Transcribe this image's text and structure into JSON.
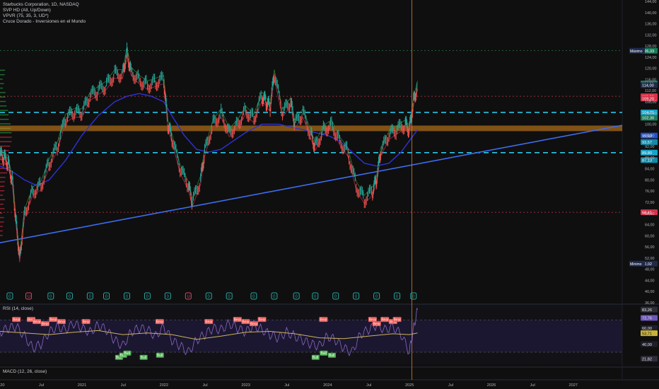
{
  "legend": {
    "symbol": "Starbucks Corporation, 1D, NASDAQ",
    "indicators": [
      "SVP HD (All, Up/Down)",
      "VPVR (75, 35, 3, UD*)",
      "Cruce Dorado - Inversiones en el Mundo"
    ]
  },
  "rsi_legend": "RSI (14, close)",
  "macd_legend": "MACD (12, 26, close)",
  "colors": {
    "background": "#0f0f0f",
    "trendline": "#3d6cf0",
    "cyan_dashed": "#27c6e6",
    "orange_zone": "#e08a1c",
    "ma_blue": "#2f32d8",
    "ma_green": "#2e8b3a",
    "ma_red": "#c8284a",
    "rsi_line": "#8768c6",
    "rsi_ma": "#c9b45a",
    "bear": "#ef5350",
    "bull": "#4caf50"
  },
  "chart_data": [
    {
      "type": "line",
      "pane": "price",
      "ylim": [
        36,
        144
      ],
      "y_ticks": [
        144,
        140,
        136,
        132,
        128,
        124,
        120,
        116,
        112,
        108,
        104,
        100,
        96,
        92,
        88,
        84,
        80,
        76,
        72,
        68,
        64,
        60,
        56,
        52,
        48,
        44,
        40,
        36
      ],
      "y_tick_labels": [
        "144,00",
        "140,00",
        "136,00",
        "132,00",
        "128,00",
        "124,00",
        "120,00",
        "116,00",
        "112,00",
        "108,00",
        "104,00",
        "100,00",
        "96,00",
        "92,00",
        "88,00",
        "84,00",
        "80,00",
        "76,00",
        "72,00",
        "68,00",
        "64,00",
        "60,00",
        "56,00",
        "52,00",
        "48,00",
        "44,00",
        "40,00",
        "36,00"
      ],
      "x_labels": [
        "2020",
        "Jul",
        "2021",
        "Jul",
        "2022",
        "Jul",
        "2023",
        "Jul",
        "2024",
        "Jul",
        "2025",
        "Jul",
        "2026",
        "Jul",
        "2027"
      ],
      "x_range": [
        2020.0,
        2027.6
      ],
      "series": [
        {
          "role": "price",
          "x": [
            2020.0,
            2020.05,
            2020.1,
            2020.15,
            2020.2,
            2020.24,
            2020.3,
            2020.4,
            2020.5,
            2020.6,
            2020.7,
            2020.8,
            2020.9,
            2021.0,
            2021.1,
            2021.2,
            2021.3,
            2021.4,
            2021.5,
            2021.55,
            2021.6,
            2021.7,
            2021.8,
            2021.9,
            2022.0,
            2022.05,
            2022.1,
            2022.2,
            2022.3,
            2022.35,
            2022.45,
            2022.5,
            2022.6,
            2022.7,
            2022.8,
            2022.9,
            2023.0,
            2023.1,
            2023.2,
            2023.25,
            2023.3,
            2023.35,
            2023.45,
            2023.55,
            2023.6,
            2023.7,
            2023.8,
            2023.85,
            2023.95,
            2024.05,
            2024.15,
            2024.25,
            2024.35,
            2024.45,
            2024.55,
            2024.6,
            2024.65,
            2024.75,
            2024.85,
            2024.95,
            2025.0,
            2025.05,
            2025.1
          ],
          "values": [
            89,
            88,
            86,
            80,
            64,
            52,
            68,
            76,
            78,
            86,
            92,
            102,
            104,
            104,
            110,
            112,
            114,
            118,
            118,
            126,
            119,
            116,
            114,
            115,
            116,
            100,
            95,
            84,
            78,
            72,
            80,
            90,
            100,
            104,
            97,
            100,
            105,
            102,
            110,
            108,
            106,
            118,
            104,
            108,
            100,
            104,
            96,
            92,
            98,
            100,
            94,
            90,
            78,
            73,
            76,
            80,
            90,
            96,
            98,
            100,
            98,
            108,
            114
          ]
        },
        {
          "role": "long-ma",
          "x": [
            2020.0,
            2020.15,
            2020.3,
            2020.45,
            2020.6,
            2020.8,
            2021.0,
            2021.2,
            2021.4,
            2021.55,
            2021.7,
            2021.85,
            2022.0,
            2022.1,
            2022.25,
            2022.4,
            2022.55,
            2022.7,
            2022.85,
            2023.0,
            2023.2,
            2023.4,
            2023.55,
            2023.7,
            2023.85,
            2024.0,
            2024.15,
            2024.3,
            2024.45,
            2024.6,
            2024.75,
            2024.9,
            2025.0,
            2025.1
          ],
          "values": [
            85,
            83,
            80,
            78,
            80,
            87,
            96,
            103,
            108,
            110,
            111,
            110,
            108,
            103,
            96,
            91,
            90,
            91,
            94,
            97,
            100,
            100,
            99,
            98,
            97,
            96,
            94,
            90,
            86,
            85,
            86,
            90,
            94,
            98
          ]
        },
        {
          "role": "trendline",
          "x": [
            2020.0,
            2027.6
          ],
          "values": [
            57.5,
            99.6
          ]
        }
      ],
      "levels": [
        {
          "y": 126.33,
          "label": "126,33",
          "note": "Máximo",
          "note_label": "126,32",
          "style": "green-dotted"
        },
        {
          "y": 114.59,
          "label": "114,59",
          "style": "green-tag"
        },
        {
          "y": 114.0,
          "label": "114,00",
          "style": "plain"
        },
        {
          "y": 110.0,
          "label": "110,00",
          "style": "red-dotted"
        },
        {
          "y": 109.2,
          "label": "109,20",
          "style": "red-tag"
        },
        {
          "y": 104.21,
          "label": "104,21",
          "style": "cyan-dashed"
        },
        {
          "y": 102.3,
          "label": "102,30",
          "style": "green-tag"
        },
        {
          "y": 95.93,
          "label": "95,93",
          "style": "blue-tag"
        },
        {
          "y": 93.57,
          "label": "93,57",
          "style": "teal-tag"
        },
        {
          "y": 89.8,
          "label": "89,80",
          "style": "cyan-dashed"
        },
        {
          "y": 87.13,
          "label": "87,13",
          "style": "teal-tag"
        },
        {
          "y": 68.41,
          "label": "68,41",
          "style": "red-dotted"
        },
        {
          "y": 50.02,
          "label": "50,02",
          "note": "Mínimo",
          "style": "plain"
        }
      ],
      "orange_zone": [
        97.5,
        99.5
      ],
      "event_markers": {
        "x": [
          2020.12,
          2020.35,
          2020.62,
          2020.85,
          2021.1,
          2021.3,
          2021.55,
          2021.8,
          2022.05,
          2022.3,
          2022.55,
          2022.8,
          2023.1,
          2023.35,
          2023.62,
          2023.85,
          2024.1,
          2024.35,
          2024.6,
          2024.85,
          2025.05
        ],
        "values": [
          "0",
          "U",
          "0",
          "0",
          "0",
          "0",
          "0",
          "0",
          "0",
          "U",
          "0",
          "0",
          "0",
          "0",
          "0",
          "0",
          "0",
          "0",
          "0",
          "0",
          "0"
        ]
      },
      "cursor_x": 2025.03
    },
    {
      "type": "line",
      "pane": "rsi",
      "ylim": [
        15,
        90
      ],
      "y_ticks": [
        83.26,
        72.76,
        60,
        53.71,
        40,
        21.82
      ],
      "y_tick_labels": [
        "83,26",
        "72,76",
        "60,00",
        "53,71",
        "40,00",
        "21,82"
      ],
      "bands": [
        70,
        30
      ],
      "signals": {
        "bear": [
          2020.2,
          2020.38,
          2020.45,
          2020.55,
          2020.65,
          2020.75,
          2021.05,
          2021.95,
          2022.55,
          2022.9,
          2023.0,
          2023.1,
          2023.2,
          2023.95,
          2024.55,
          2024.6,
          2024.7,
          2024.8,
          2024.85
        ],
        "bull": [
          2021.45,
          2021.5,
          2021.55,
          2021.75,
          2021.95,
          2023.85,
          2023.95,
          2024.05
        ],
        "label_bear": "Bear",
        "label_bull": "Bull"
      },
      "series": [
        {
          "role": "rsi",
          "x": [
            2020.0,
            2020.1,
            2020.2,
            2020.3,
            2020.4,
            2020.5,
            2020.6,
            2020.7,
            2020.8,
            2020.9,
            2021.0,
            2021.1,
            2021.2,
            2021.3,
            2021.4,
            2021.5,
            2021.6,
            2021.7,
            2021.8,
            2021.9,
            2022.0,
            2022.1,
            2022.2,
            2022.3,
            2022.4,
            2022.5,
            2022.6,
            2022.7,
            2022.8,
            2022.9,
            2023.0,
            2023.1,
            2023.2,
            2023.3,
            2023.4,
            2023.5,
            2023.6,
            2023.7,
            2023.8,
            2023.9,
            2024.0,
            2024.1,
            2024.2,
            2024.3,
            2024.4,
            2024.5,
            2024.6,
            2024.7,
            2024.8,
            2024.9,
            2025.0,
            2025.05,
            2025.1
          ],
          "values": [
            55,
            60,
            62,
            50,
            35,
            40,
            55,
            62,
            58,
            66,
            60,
            55,
            64,
            58,
            45,
            38,
            55,
            60,
            58,
            50,
            62,
            45,
            38,
            30,
            45,
            52,
            60,
            58,
            66,
            60,
            55,
            64,
            58,
            52,
            48,
            55,
            50,
            45,
            40,
            38,
            50,
            45,
            35,
            30,
            52,
            58,
            64,
            58,
            62,
            52,
            30,
            60,
            83
          ]
        },
        {
          "role": "rsi-ma",
          "x": [
            2020.0,
            2020.3,
            2020.6,
            2020.9,
            2021.2,
            2021.5,
            2021.8,
            2022.1,
            2022.4,
            2022.7,
            2023.0,
            2023.3,
            2023.6,
            2023.9,
            2024.2,
            2024.5,
            2024.8,
            2025.0,
            2025.1
          ],
          "values": [
            56,
            54,
            52,
            55,
            57,
            52,
            54,
            52,
            46,
            50,
            55,
            56,
            53,
            48,
            47,
            50,
            53,
            52,
            54
          ]
        }
      ]
    }
  ]
}
